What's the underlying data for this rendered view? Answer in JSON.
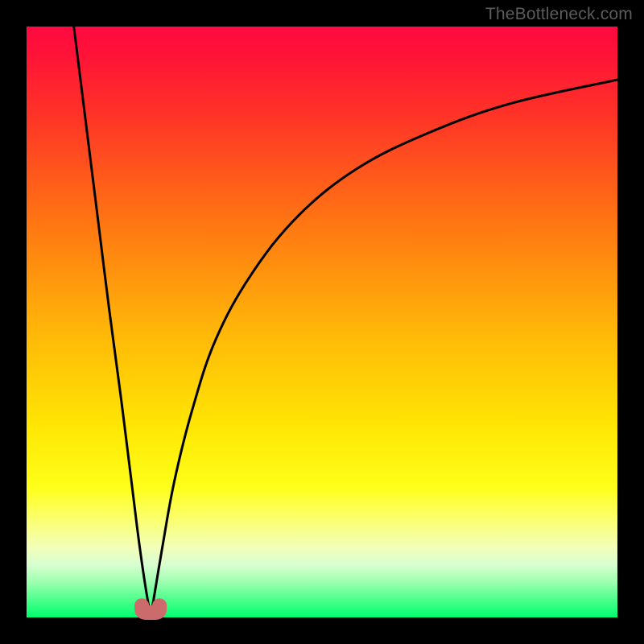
{
  "watermark": "TheBottleneck.com",
  "colors": {
    "frame": "#000000",
    "watermark": "#5b5b5b",
    "curve": "#000000",
    "marker": "#cc6b6b",
    "gradient_top": "#ff0a41",
    "gradient_bottom": "#00ff6e"
  },
  "chart_data": {
    "type": "line",
    "title": "",
    "xlabel": "",
    "ylabel": "",
    "xlim": [
      0,
      100
    ],
    "ylim": [
      0,
      100
    ],
    "grid": false,
    "legend": false,
    "background": "heatmap-gradient vertical (bottleneck %): ~0 green → ~100 red",
    "annotations": [
      "TheBottleneck.com"
    ],
    "min_x": 21,
    "series": [
      {
        "name": "left-branch",
        "x": [
          8,
          10,
          12,
          14,
          16,
          18,
          19,
          20,
          21
        ],
        "values": [
          100,
          84,
          68,
          52,
          37,
          21,
          13,
          6,
          0
        ]
      },
      {
        "name": "right-branch",
        "x": [
          21,
          23,
          25,
          28,
          32,
          38,
          46,
          56,
          68,
          82,
          100
        ],
        "values": [
          0,
          12,
          23,
          35,
          47,
          58,
          68,
          76,
          82,
          87,
          91
        ]
      }
    ],
    "markers": [
      {
        "x": 19.5,
        "y": 2
      },
      {
        "x": 22.5,
        "y": 2
      }
    ]
  }
}
